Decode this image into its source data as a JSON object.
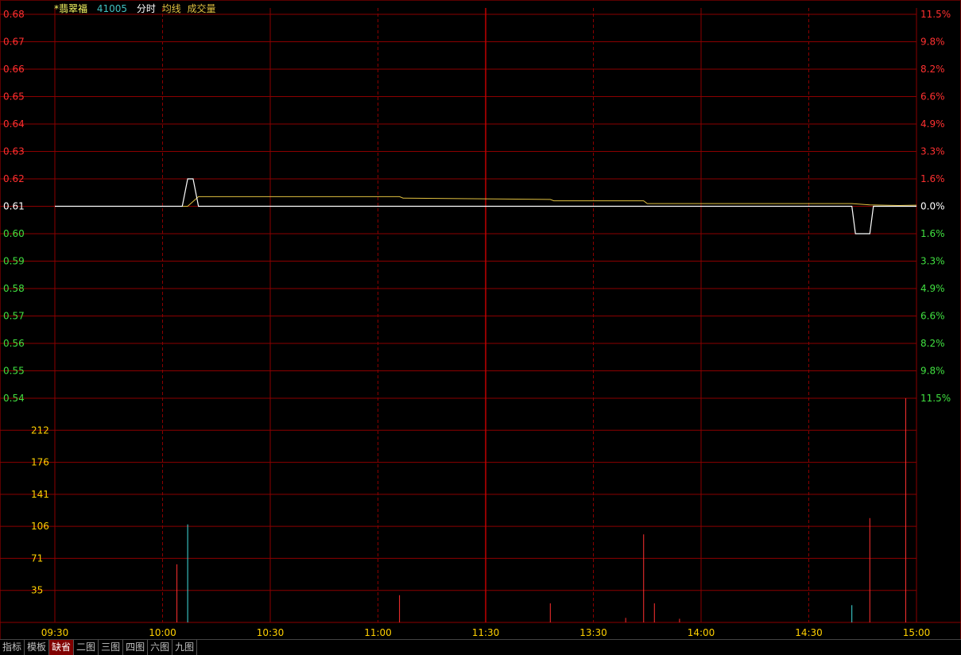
{
  "header": {
    "stock_name": "*翡翠福",
    "stock_code": "41005",
    "label_intraday": "分时",
    "label_avg": "均线",
    "label_volume": "成交量"
  },
  "colors": {
    "grid": "#8b0000",
    "up": "#ff3030",
    "down": "#40e040",
    "neutral": "#ffffff",
    "avg_line": "#e0c040",
    "price_line": "#ffffff",
    "volume_tick": "#ffd000",
    "volume_up": "#ff3030",
    "volume_down": "#40e0e0"
  },
  "chart_data": [
    {
      "type": "line",
      "title": "",
      "ylim": [
        0.54,
        0.68
      ],
      "y_ticks_left": [
        "0.68",
        "0.67",
        "0.66",
        "0.65",
        "0.64",
        "0.63",
        "0.62",
        "0.61",
        "0.60",
        "0.59",
        "0.58",
        "0.57",
        "0.56",
        "0.55",
        "0.54"
      ],
      "y_ticks_right": [
        "11.5%",
        "9.8%",
        "8.2%",
        "6.6%",
        "4.9%",
        "3.3%",
        "1.6%",
        "0.0%",
        "1.6%",
        "3.3%",
        "4.9%",
        "6.6%",
        "8.2%",
        "9.8%",
        "11.5%"
      ],
      "reference_price": 0.61,
      "x_ticks": [
        "09:30",
        "10:00",
        "10:30",
        "11:00",
        "11:30",
        "13:30",
        "14:00",
        "14:30",
        "15:00"
      ],
      "series": [
        {
          "points": [
            [
              0,
              0.61
            ],
            [
              35.5,
              0.61
            ],
            [
              37,
              0.62
            ],
            [
              38.5,
              0.62
            ],
            [
              40,
              0.61
            ],
            [
              222,
              0.61
            ],
            [
              223,
              0.6
            ],
            [
              227,
              0.6
            ],
            [
              228,
              0.61
            ],
            [
              240,
              0.61
            ]
          ]
        },
        {
          "points": [
            [
              0,
              0.61
            ],
            [
              37,
              0.61
            ],
            [
              40,
              0.6135
            ],
            [
              96,
              0.6135
            ],
            [
              97,
              0.613
            ],
            [
              138,
              0.6125
            ],
            [
              139,
              0.612
            ],
            [
              164,
              0.612
            ],
            [
              165,
              0.611
            ],
            [
              222,
              0.611
            ],
            [
              227,
              0.6105
            ],
            [
              235,
              0.6103
            ],
            [
              240,
              0.6104
            ]
          ]
        }
      ]
    },
    {
      "type": "bar",
      "title": "",
      "ylim": [
        0,
        247
      ],
      "y_ticks": [
        "212",
        "176",
        "141",
        "106",
        "71",
        "35"
      ],
      "bars": [
        {
          "minute": 34,
          "value": 64,
          "dir": "up"
        },
        {
          "minute": 37,
          "value": 108,
          "dir": "down"
        },
        {
          "minute": 96,
          "value": 30,
          "dir": "up"
        },
        {
          "minute": 138,
          "value": 21,
          "dir": "up"
        },
        {
          "minute": 159,
          "value": 5,
          "dir": "up"
        },
        {
          "minute": 164,
          "value": 97,
          "dir": "up"
        },
        {
          "minute": 167,
          "value": 21,
          "dir": "up"
        },
        {
          "minute": 174,
          "value": 4,
          "dir": "up"
        },
        {
          "minute": 222,
          "value": 19,
          "dir": "down"
        },
        {
          "minute": 227,
          "value": 115,
          "dir": "up"
        },
        {
          "minute": 237,
          "value": 247,
          "dir": "up"
        }
      ]
    }
  ],
  "tabs": [
    "指标",
    "模板",
    "缺省",
    "二图",
    "三图",
    "四图",
    "六图",
    "九图"
  ],
  "active_tab": "缺省"
}
